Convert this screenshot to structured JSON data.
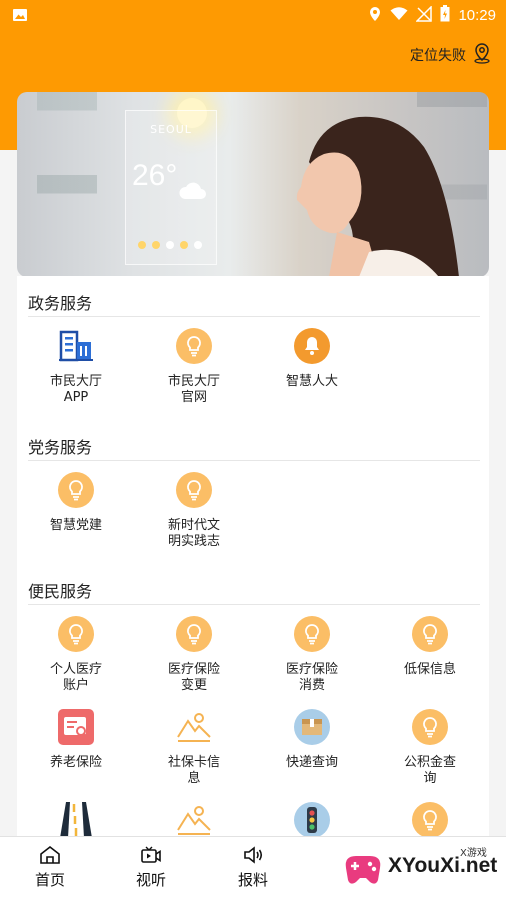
{
  "status": {
    "time": "10:29"
  },
  "header": {
    "location_text": "定位失败"
  },
  "banner": {
    "city": "SEOUL",
    "temp": "26°"
  },
  "sections": [
    {
      "title": "政务服务",
      "items": [
        {
          "label_lines": [
            "市民大厅",
            "APP"
          ],
          "icon": "building-icon"
        },
        {
          "label_lines": [
            "市民大厅",
            "官网"
          ],
          "icon": "bulb-icon"
        },
        {
          "label_lines": [
            "智慧人大"
          ],
          "icon": "bell-icon"
        }
      ]
    },
    {
      "title": "党务服务",
      "items": [
        {
          "label_lines": [
            "智慧党建"
          ],
          "icon": "bulb-icon"
        },
        {
          "label_lines": [
            "新时代文",
            "明实践志"
          ],
          "icon": "bulb-icon"
        }
      ]
    },
    {
      "title": "便民服务",
      "items": [
        {
          "label_lines": [
            "个人医疗",
            "账户"
          ],
          "icon": "bulb-icon"
        },
        {
          "label_lines": [
            "医疗保险",
            "变更"
          ],
          "icon": "bulb-icon"
        },
        {
          "label_lines": [
            "医疗保险",
            "消费"
          ],
          "icon": "bulb-icon"
        },
        {
          "label_lines": [
            "低保信息"
          ],
          "icon": "bulb-icon"
        },
        {
          "label_lines": [
            "养老保险"
          ],
          "icon": "document-search-icon"
        },
        {
          "label_lines": [
            "社保卡信",
            "息"
          ],
          "icon": "landscape-icon"
        },
        {
          "label_lines": [
            "快递查询"
          ],
          "icon": "package-icon"
        },
        {
          "label_lines": [
            "公积金查",
            "询"
          ],
          "icon": "bulb-icon"
        },
        {
          "label_lines": [
            ""
          ],
          "icon": "road-icon"
        },
        {
          "label_lines": [
            ""
          ],
          "icon": "landscape-icon"
        },
        {
          "label_lines": [
            ""
          ],
          "icon": "traffic-light-icon"
        },
        {
          "label_lines": [
            ""
          ],
          "icon": "bulb-icon"
        }
      ]
    }
  ],
  "nav": [
    {
      "label": "首页",
      "icon": "home-icon"
    },
    {
      "label": "视听",
      "icon": "video-icon"
    },
    {
      "label": "报料",
      "icon": "speaker-icon"
    }
  ],
  "watermark": {
    "brand": "XYouXi.net",
    "small": "X游戏"
  },
  "colors": {
    "accent": "#fe9a02",
    "bulb": "#fbbe66"
  }
}
